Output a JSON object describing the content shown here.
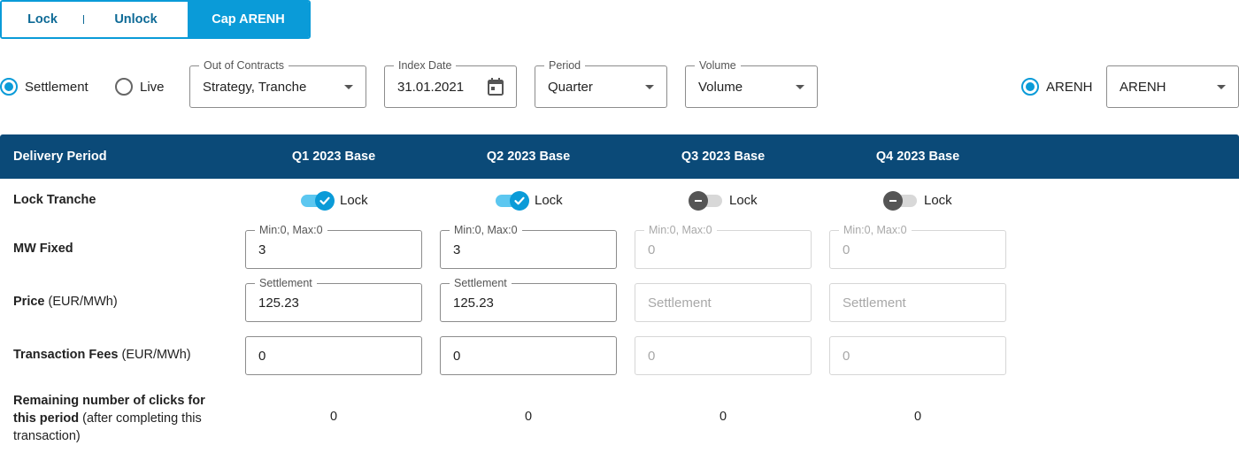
{
  "tabs": {
    "lock": "Lock",
    "unlock": "Unlock",
    "cap": "Cap ARENH"
  },
  "mode": {
    "settlement": "Settlement",
    "live": "Live",
    "selected": "Settlement"
  },
  "filters": {
    "out_of_contracts": {
      "label": "Out of Contracts",
      "value": "Strategy, Tranche"
    },
    "index_date": {
      "label": "Index Date",
      "value": "31.01.2021"
    },
    "period": {
      "label": "Period",
      "value": "Quarter"
    },
    "volume": {
      "label": "Volume",
      "value": "Volume"
    },
    "arenh_radio": "ARENH",
    "arenh_select": {
      "value": "ARENH"
    }
  },
  "table": {
    "header_first": "Delivery Period",
    "columns": [
      "Q1 2023 Base",
      "Q2 2023 Base",
      "Q3 2023 Base",
      "Q4 2023 Base"
    ],
    "rows": {
      "lock_tranche": {
        "label": "Lock Tranche"
      },
      "mw_fixed": {
        "label": "MW Fixed"
      },
      "price": {
        "label": "Price",
        "unit": "(EUR/MWh)"
      },
      "fees": {
        "label": "Transaction Fees",
        "unit": "(EUR/MWh)"
      },
      "clicks": {
        "label_bold": "Remaining number of clicks for this period",
        "label_rest": "(after completing this transaction)"
      }
    },
    "cells": [
      {
        "lock_label": "Lock",
        "locked": true,
        "mw_label": "Min:0, Max:0",
        "mw_value": "3",
        "price_label": "Settlement",
        "price_value": "125.23",
        "price_placeholder": "",
        "fees_value": "0",
        "clicks": "0",
        "enabled": true
      },
      {
        "lock_label": "Lock",
        "locked": true,
        "mw_label": "Min:0, Max:0",
        "mw_value": "3",
        "price_label": "Settlement",
        "price_value": "125.23",
        "price_placeholder": "",
        "fees_value": "0",
        "clicks": "0",
        "enabled": true
      },
      {
        "lock_label": "Lock",
        "locked": false,
        "mw_label": "Min:0, Max:0",
        "mw_value": "0",
        "price_label": "",
        "price_value": "",
        "price_placeholder": "Settlement",
        "fees_value": "0",
        "clicks": "0",
        "enabled": false
      },
      {
        "lock_label": "Lock",
        "locked": false,
        "mw_label": "Min:0, Max:0",
        "mw_value": "0",
        "price_label": "",
        "price_value": "",
        "price_placeholder": "Settlement",
        "fees_value": "0",
        "clicks": "0",
        "enabled": false
      }
    ]
  },
  "colors": {
    "accent": "#0a9bd8",
    "header_bg": "#0b4a78",
    "toggle_on_track": "#5cc7f0"
  }
}
